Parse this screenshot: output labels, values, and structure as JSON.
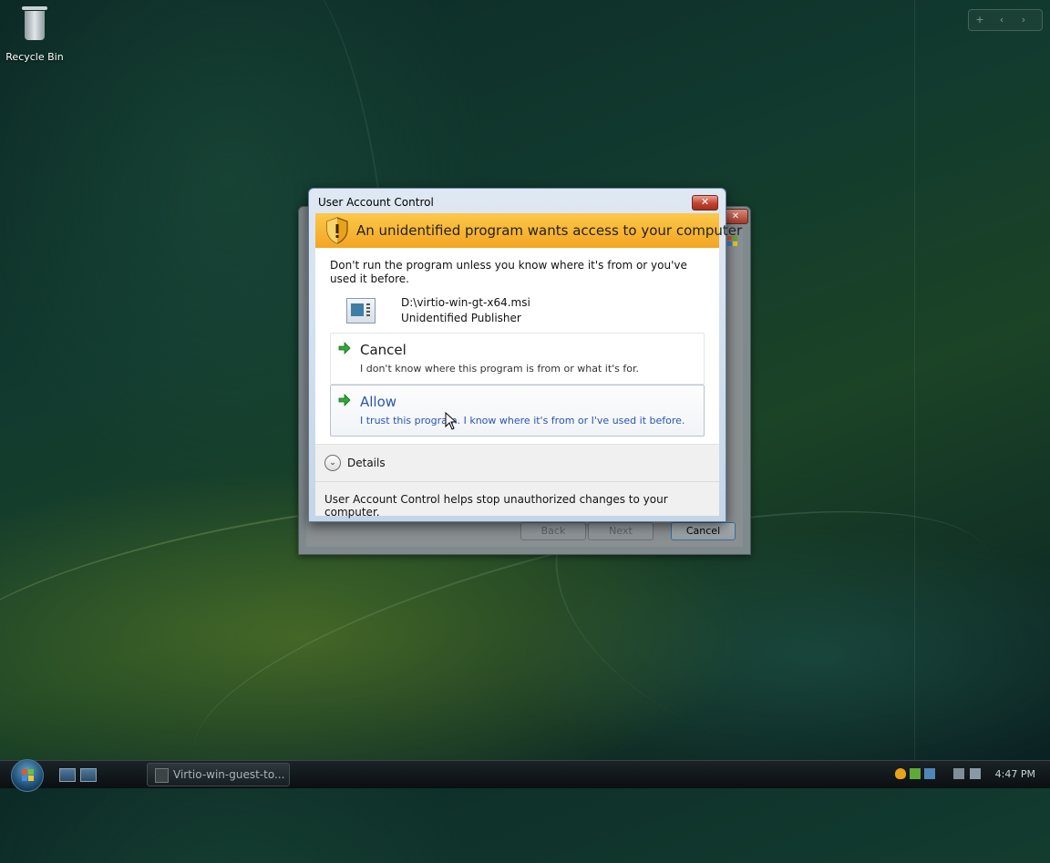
{
  "desktop": {
    "recycle_bin_label": "Recycle Bin"
  },
  "background_window": {
    "close_glyph": "✕",
    "back_label": "Back",
    "next_label": "Next",
    "cancel_label": "Cancel"
  },
  "uac": {
    "title": "User Account Control",
    "close_glyph": "✕",
    "banner": "An unidentified program wants access to your computer",
    "warning": "Don't run the program unless you know where it's from or you've used it before.",
    "program_path": "D:\\virtio-win-gt-x64.msi",
    "publisher": "Unidentified Publisher",
    "options": [
      {
        "heading": "Cancel",
        "description": "I don't know where this program is from or what it's for."
      },
      {
        "heading": "Allow",
        "description": "I trust this program. I know where it's from or I've used it before."
      }
    ],
    "details_label": "Details",
    "details_chevron": "⌄",
    "footer": "User Account Control helps stop unauthorized changes to your computer."
  },
  "sidebar": {
    "add_glyph": "+",
    "prev_glyph": "‹",
    "next_glyph": "›"
  },
  "taskbar": {
    "task_label": "Virtio-win-guest-to...",
    "clock": "4:47 PM"
  },
  "colors": {
    "banner": "#f6b02c",
    "link_blue": "#2a55b4",
    "arrow_green": "#2fa836"
  }
}
